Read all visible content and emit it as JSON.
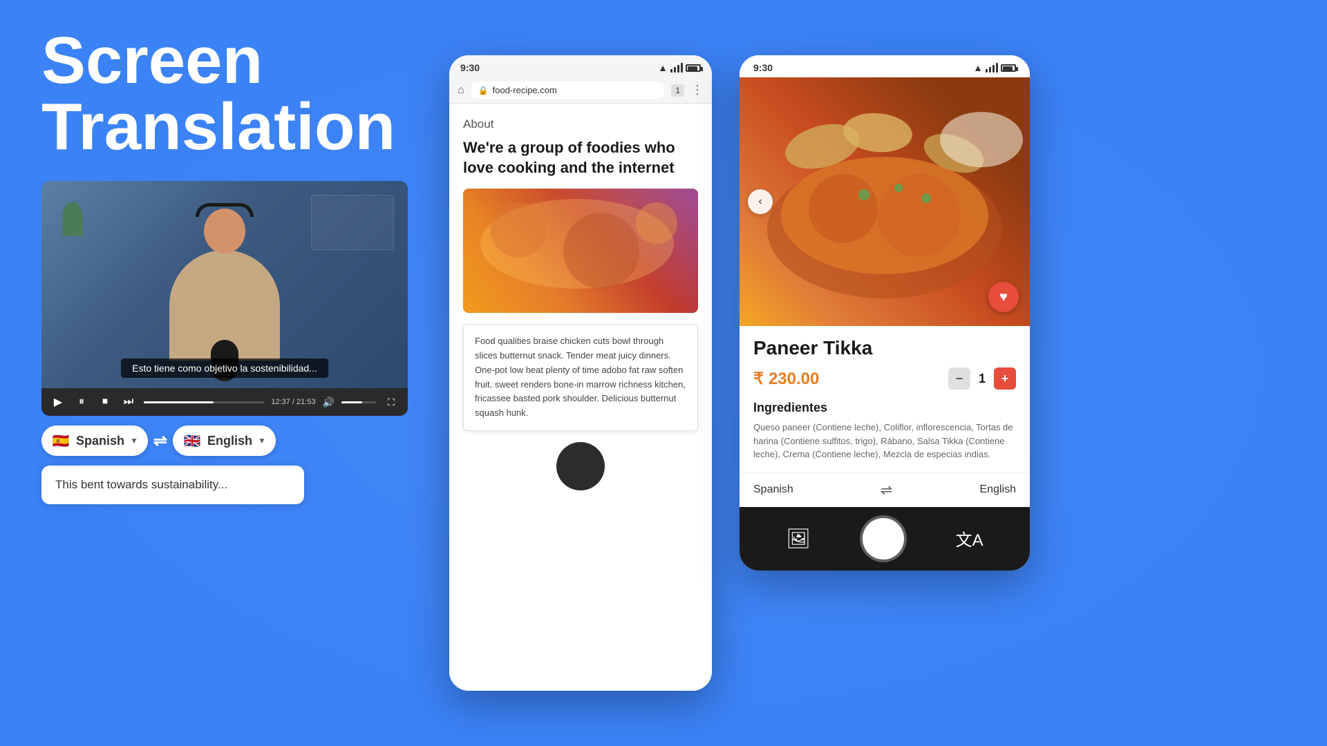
{
  "page": {
    "title": "Screen Translation",
    "background_color": "#3b82f6"
  },
  "heading": {
    "line1": "Screen",
    "line2": "Translation"
  },
  "video": {
    "subtitle": "Esto tiene como objetivo la sostenibilidad...",
    "time_current": "12:37",
    "time_total": "21:53",
    "progress_percent": 58
  },
  "lang_selector": {
    "source_lang": "Spanish",
    "target_lang": "English",
    "source_flag": "🇪🇸",
    "target_flag": "🇬🇧",
    "swap_label": "⇌"
  },
  "translation_box": {
    "text": "This bent towards sustainability..."
  },
  "browser": {
    "status_time": "9:30",
    "url": "food-recipe.com",
    "about_label": "About",
    "headline": "We're a group of foodies who love cooking and the internet",
    "description": "Food qualities braise chicken cuts bowl through slices butternut snack. Tender meat juicy dinners. One-pot low heat plenty of time adobo fat raw soften fruit. sweet renders bone-in marrow richness kitchen, fricassee basted pork shoulder. Delicious butternut squash hunk."
  },
  "recipe_app": {
    "status_time": "9:30",
    "dish_name": "Paneer Tikka",
    "price": "₹ 230.00",
    "quantity": 1,
    "ingredients_label": "Ingredientes",
    "ingredients_text": "Queso paneer (Contiene leche), Coliflor, inflorescencia, Tortas de harina (Contiene sulfitos, trigo), Rábano, Salsa Tikka (Contiene leche), Crema (Contiene leche), Mezcla de especias indias.",
    "bottom_source_lang": "Spanish",
    "bottom_target_lang": "English"
  },
  "icons": {
    "play": "▶",
    "pause": "⏸",
    "stop": "⏹",
    "next": "⏭",
    "volume": "🔊",
    "fullscreen": "⛶",
    "heart": "♥",
    "gallery": "🖼",
    "translate": "文A",
    "arrow_left": "‹",
    "minus": "−",
    "plus": "+"
  }
}
